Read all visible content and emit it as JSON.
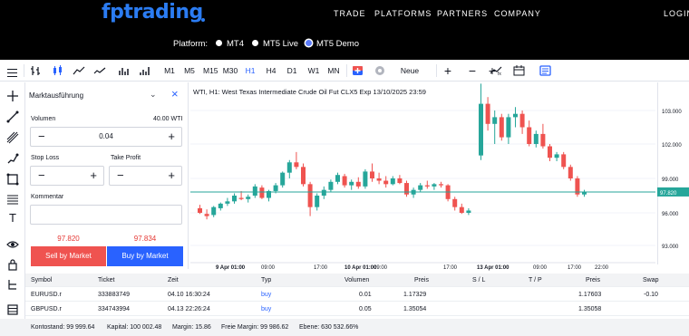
{
  "brand": {
    "name": "fptrading",
    "color": "#2b7cf2"
  },
  "nav": {
    "links": [
      "TRADE",
      "PLATFORMS",
      "PARTNERS",
      "COMPANY"
    ],
    "login": "LOGIN"
  },
  "platform": {
    "label": "Platform:",
    "options": [
      "MT4",
      "MT5 Live",
      "MT5 Demo"
    ],
    "selected": "MT5 Demo"
  },
  "toolbar": {
    "timeframes": [
      "M1",
      "M5",
      "M15",
      "M30",
      "H1",
      "H4",
      "D1",
      "W1",
      "MN"
    ],
    "active_timeframe": "H1",
    "new_order": "Neue Order",
    "icons": [
      "menu-icon",
      "bar-chart-icon",
      "candlestick-icon",
      "area-icon",
      "line-icon",
      "volume-icon",
      "crosshair-icon",
      "add-icon",
      "zoom-out-icon",
      "zoom-in-icon",
      "indicator-icon",
      "calendar-icon",
      "template-icon"
    ]
  },
  "drawing_tools": [
    "crosshair-icon",
    "trendline-icon",
    "pen-icon",
    "brush-icon",
    "rectangle-icon",
    "fib-icon",
    "text-icon",
    "eye-icon",
    "lock-icon",
    "tree-icon",
    "layers-icon",
    "list-icon"
  ],
  "order_panel": {
    "type": "Marktausführung",
    "volume_label": "Volumen",
    "volume_hint": "40.00 WTI",
    "volume_value": "0.04",
    "stop_loss_label": "Stop Loss",
    "take_profit_label": "Take Profit",
    "stop_loss_value": "",
    "take_profit_value": "",
    "comment_label": "Kommentar",
    "comment_value": "",
    "bid": "97.820",
    "ask": "97.834",
    "sell_label": "Sell by Market",
    "buy_label": "Buy by Market",
    "sell_color": "#ef5350",
    "buy_color": "#2962ff"
  },
  "chart_data": {
    "type": "candlestick",
    "title": "WTI, H1: West Texas Intermediate Crude Oil Fut CLX5 Exp 13/10/2025 23:59",
    "y_ticks": [
      "103.000",
      "102.000",
      "99.000",
      "96.000",
      "93.000"
    ],
    "y_values": [
      103,
      102,
      99,
      96,
      93
    ],
    "x_ticks": [
      "9 Apr 01:00",
      "09:00",
      "17:00",
      "10 Apr 01:00",
      "09:00",
      "17:00",
      "13 Apr 01:00",
      "09:00",
      "17:00",
      "22:00"
    ],
    "x_ticks_bold": [
      "9 Apr 01:00",
      "10 Apr 01:00",
      "13 Apr 01:00"
    ],
    "current_price": "97.820",
    "up_color": "#26a69a",
    "down_color": "#ef5350",
    "candles": [
      {
        "o": 96.4,
        "h": 96.7,
        "l": 95.9,
        "c": 96.0
      },
      {
        "o": 95.9,
        "h": 96.3,
        "l": 95.4,
        "c": 95.7
      },
      {
        "o": 95.8,
        "h": 96.6,
        "l": 95.6,
        "c": 96.5
      },
      {
        "o": 96.4,
        "h": 96.9,
        "l": 96.2,
        "c": 96.8
      },
      {
        "o": 96.8,
        "h": 97.3,
        "l": 96.6,
        "c": 97.0
      },
      {
        "o": 97.0,
        "h": 97.7,
        "l": 96.8,
        "c": 97.5
      },
      {
        "o": 97.3,
        "h": 97.9,
        "l": 97.1,
        "c": 97.2
      },
      {
        "o": 97.2,
        "h": 97.6,
        "l": 96.9,
        "c": 97.4
      },
      {
        "o": 97.5,
        "h": 98.5,
        "l": 97.3,
        "c": 98.3
      },
      {
        "o": 98.2,
        "h": 98.4,
        "l": 97.2,
        "c": 97.3
      },
      {
        "o": 97.3,
        "h": 98.0,
        "l": 97.0,
        "c": 97.9
      },
      {
        "o": 97.9,
        "h": 98.6,
        "l": 97.7,
        "c": 98.4
      },
      {
        "o": 98.4,
        "h": 99.6,
        "l": 98.2,
        "c": 99.5
      },
      {
        "o": 99.5,
        "h": 100.6,
        "l": 99.0,
        "c": 100.4
      },
      {
        "o": 100.4,
        "h": 101.3,
        "l": 99.8,
        "c": 100.0
      },
      {
        "o": 100.0,
        "h": 100.3,
        "l": 98.3,
        "c": 98.5
      },
      {
        "o": 98.5,
        "h": 98.7,
        "l": 95.7,
        "c": 96.5
      },
      {
        "o": 96.5,
        "h": 97.7,
        "l": 96.2,
        "c": 97.5
      },
      {
        "o": 97.5,
        "h": 98.3,
        "l": 97.2,
        "c": 98.0
      },
      {
        "o": 98.0,
        "h": 98.9,
        "l": 97.8,
        "c": 98.7
      },
      {
        "o": 98.7,
        "h": 99.5,
        "l": 98.5,
        "c": 99.3
      },
      {
        "o": 99.2,
        "h": 99.4,
        "l": 98.2,
        "c": 98.4
      },
      {
        "o": 98.4,
        "h": 98.9,
        "l": 98.0,
        "c": 98.7
      },
      {
        "o": 98.7,
        "h": 99.1,
        "l": 98.1,
        "c": 98.3
      },
      {
        "o": 98.3,
        "h": 99.8,
        "l": 98.1,
        "c": 99.6
      },
      {
        "o": 99.6,
        "h": 100.3,
        "l": 98.7,
        "c": 99.0
      },
      {
        "o": 99.0,
        "h": 99.5,
        "l": 98.5,
        "c": 98.8
      },
      {
        "o": 98.8,
        "h": 99.2,
        "l": 98.2,
        "c": 98.5
      },
      {
        "o": 98.5,
        "h": 99.2,
        "l": 98.4,
        "c": 99.0
      },
      {
        "o": 99.0,
        "h": 99.3,
        "l": 98.5,
        "c": 98.6
      },
      {
        "o": 98.6,
        "h": 98.8,
        "l": 97.4,
        "c": 97.6
      },
      {
        "o": 97.6,
        "h": 98.2,
        "l": 97.3,
        "c": 98.0
      },
      {
        "o": 98.0,
        "h": 98.6,
        "l": 97.8,
        "c": 98.4
      },
      {
        "o": 98.4,
        "h": 98.8,
        "l": 98.1,
        "c": 98.3
      },
      {
        "o": 98.3,
        "h": 98.6,
        "l": 98.0,
        "c": 98.5
      },
      {
        "o": 98.5,
        "h": 98.7,
        "l": 98.2,
        "c": 98.4
      },
      {
        "o": 98.4,
        "h": 98.5,
        "l": 97.0,
        "c": 97.2
      },
      {
        "o": 97.2,
        "h": 97.4,
        "l": 96.2,
        "c": 96.5
      },
      {
        "o": 96.5,
        "h": 96.8,
        "l": 95.9,
        "c": 96.0
      },
      {
        "o": 96.0,
        "h": 96.4,
        "l": 95.8,
        "c": 96.2
      },
      {
        "o": 101.0,
        "h": 103.8,
        "l": 100.6,
        "c": 103.2
      },
      {
        "o": 103.2,
        "h": 103.4,
        "l": 102.4,
        "c": 102.6
      },
      {
        "o": 102.6,
        "h": 103.0,
        "l": 102.0,
        "c": 102.8
      },
      {
        "o": 102.8,
        "h": 102.9,
        "l": 102.1,
        "c": 102.2
      },
      {
        "o": 102.2,
        "h": 102.9,
        "l": 102.0,
        "c": 102.8
      },
      {
        "o": 102.8,
        "h": 103.1,
        "l": 102.5,
        "c": 102.9
      },
      {
        "o": 102.9,
        "h": 103.0,
        "l": 102.3,
        "c": 102.5
      },
      {
        "o": 102.5,
        "h": 102.7,
        "l": 101.8,
        "c": 102.0
      },
      {
        "o": 102.0,
        "h": 102.4,
        "l": 101.7,
        "c": 102.3
      },
      {
        "o": 102.3,
        "h": 102.6,
        "l": 101.6,
        "c": 101.8
      },
      {
        "o": 101.8,
        "h": 102.0,
        "l": 100.5,
        "c": 100.8
      },
      {
        "o": 100.8,
        "h": 101.3,
        "l": 100.5,
        "c": 101.1
      },
      {
        "o": 101.1,
        "h": 101.3,
        "l": 99.8,
        "c": 100.0
      },
      {
        "o": 100.0,
        "h": 100.2,
        "l": 98.8,
        "c": 99.0
      },
      {
        "o": 99.0,
        "h": 99.2,
        "l": 97.4,
        "c": 97.6
      },
      {
        "o": 97.6,
        "h": 98.0,
        "l": 97.4,
        "c": 97.82
      }
    ]
  },
  "positions": {
    "headers": [
      "Symbol",
      "Ticket",
      "Zeit",
      "Typ",
      "Volumen",
      "Preis",
      "S / L",
      "T / P",
      "Preis",
      "Swap"
    ],
    "rows": [
      [
        "EURUSD.r",
        "333883749",
        "04.10 16:30:24",
        "buy",
        "0.01",
        "1.17329",
        "",
        "",
        "1.17603",
        "-0.10"
      ],
      [
        "GBPUSD.r",
        "334743994",
        "04.13 22:26:24",
        "buy",
        "0.05",
        "1.35054",
        "",
        "",
        "1.35058",
        ""
      ]
    ]
  },
  "account": {
    "balance": "Kontostand: 99 999.64",
    "capital": "Kapital: 100 002.48",
    "margin": "Margin: 15.86",
    "free_margin": "Freie Margin: 99 986.62",
    "level": "Ebene: 630 532.66%"
  }
}
